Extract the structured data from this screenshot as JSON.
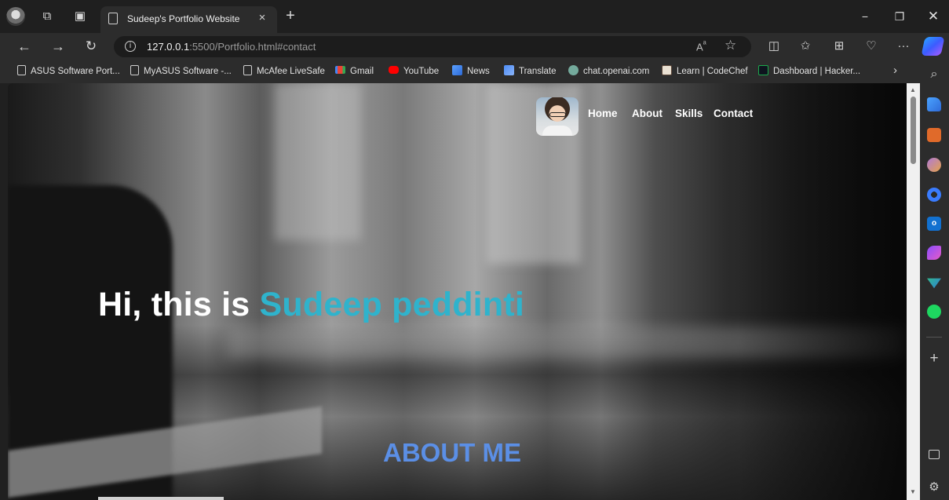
{
  "browser": {
    "tab": {
      "title": "Sudeep's Portfolio Website",
      "close_glyph": "×"
    },
    "new_tab_glyph": "+",
    "window_controls": {
      "minimize": "−",
      "restore": "❐",
      "close": "✕"
    },
    "address": {
      "host": "127.0.0.1",
      "path": ":5500/Portfolio.html#contact"
    },
    "bookmarks": [
      {
        "label": "ASUS Software Port...",
        "icon": "page-icon"
      },
      {
        "label": "MyASUS Software -...",
        "icon": "page-icon"
      },
      {
        "label": "McAfee LiveSafe",
        "icon": "page-icon"
      },
      {
        "label": "Gmail",
        "icon": "gmail-icon"
      },
      {
        "label": "YouTube",
        "icon": "youtube-icon"
      },
      {
        "label": "News",
        "icon": "news-icon"
      },
      {
        "label": "Translate",
        "icon": "translate-icon"
      },
      {
        "label": "chat.openai.com",
        "icon": "openai-icon"
      },
      {
        "label": "Learn | CodeChef",
        "icon": "codechef-icon"
      },
      {
        "label": "Dashboard | Hacker...",
        "icon": "hackerrank-icon"
      }
    ]
  },
  "site": {
    "nav": {
      "home": "Home",
      "about": "About",
      "skills": "Skills",
      "contact": "Contact"
    },
    "hero": {
      "greeting": "Hi, this is",
      "name": "Sudeep peddinti"
    },
    "about_heading": "ABOUT ME"
  },
  "colors": {
    "accent_name": "#2fb3cc",
    "about_heading": "#5b8fe6",
    "nav_text": "#ffffff"
  }
}
